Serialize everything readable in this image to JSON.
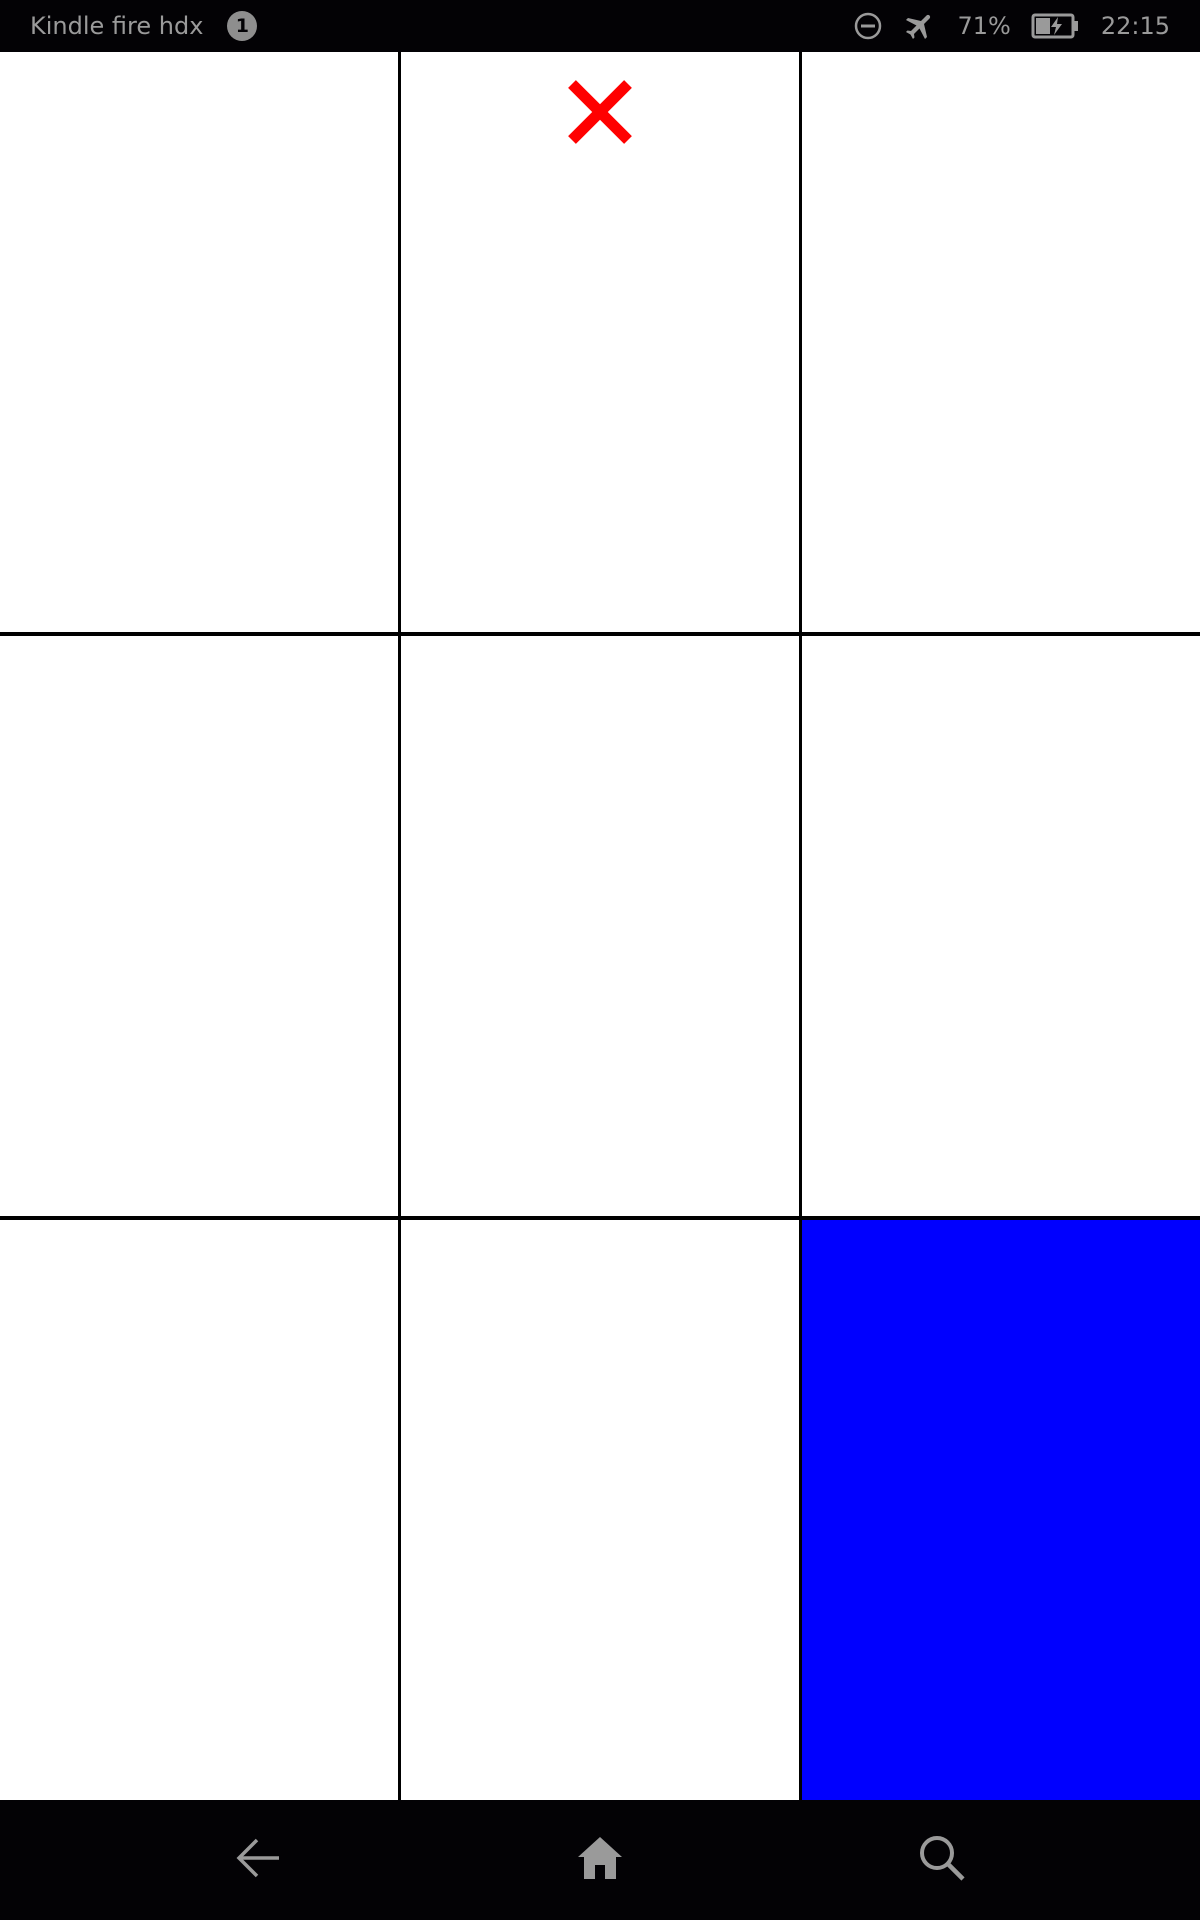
{
  "status_bar": {
    "device_name": "Kindle fire hdx",
    "notification_count": "1",
    "battery_percent": "71%",
    "time": "22:15",
    "icons": [
      "do-not-disturb-icon",
      "airplane-mode-icon",
      "battery-charging-icon"
    ]
  },
  "board": {
    "rows": 3,
    "columns": 3,
    "cells": [
      {
        "mark": ""
      },
      {
        "mark": "X"
      },
      {
        "mark": ""
      },
      {
        "mark": ""
      },
      {
        "mark": ""
      },
      {
        "mark": ""
      },
      {
        "mark": ""
      },
      {
        "mark": ""
      },
      {
        "mark": "",
        "highlighted": true
      }
    ],
    "colors": {
      "cell": "#ffffff",
      "grid_line": "#000000",
      "highlight": "#0000ff",
      "x_mark": "#ff0000"
    }
  },
  "nav_bar": {
    "icons": [
      "back-arrow-icon",
      "home-icon",
      "search-icon"
    ]
  }
}
